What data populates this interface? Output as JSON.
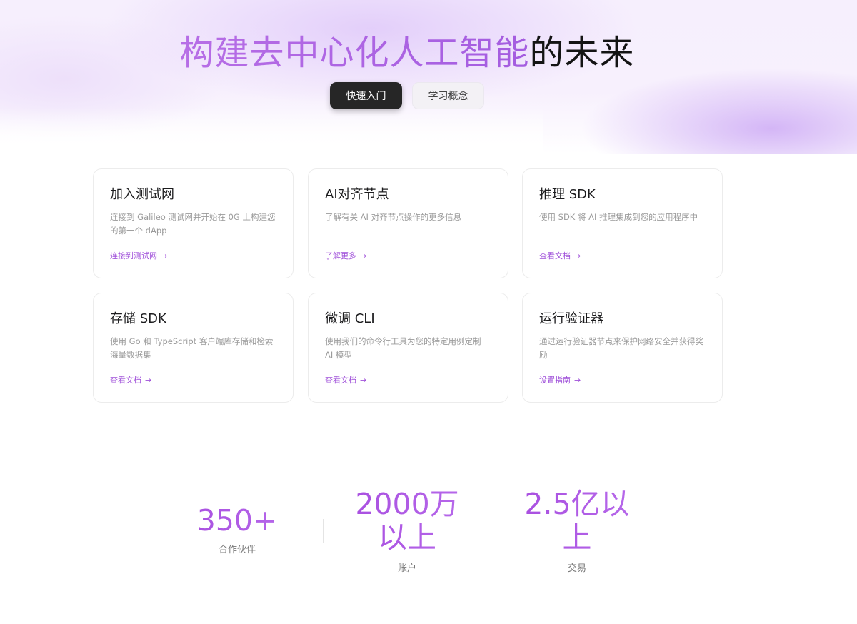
{
  "hero": {
    "title_gradient": "构建去中心化人工智能",
    "title_dark": "的未来",
    "primary_button": "快速入门",
    "secondary_button": "学习概念"
  },
  "cards": [
    {
      "title": "加入测试网",
      "desc_line1": "连接到 Galileo 测试网并开始在 0G 上构建您",
      "desc_line2": "的第一个 dApp",
      "link": "连接到测试网",
      "arrow": "→"
    },
    {
      "title": "AI对齐节点",
      "desc_line1": "了解有关 AI 对齐节点操作的更多信息",
      "desc_line2": "",
      "link": "了解更多",
      "arrow": "→"
    },
    {
      "title": "推理 SDK",
      "desc_line1": "使用 SDK 将 AI 推理集成到您的应用程序中",
      "desc_line2": "",
      "link": "查看文档",
      "arrow": "→"
    },
    {
      "title": "存储 SDK",
      "desc_line1": "使用 Go 和 TypeScript 客户端库存储和检索",
      "desc_line2": "海量数据集",
      "link": "查看文档",
      "arrow": "→"
    },
    {
      "title": "微调 CLI",
      "desc_line1": "使用我们的命令行工具为您的特定用例定制",
      "desc_line2": "AI 模型",
      "link": "查看文档",
      "arrow": "→"
    },
    {
      "title": "运行验证器",
      "desc_line1": "通过运行验证器节点来保护网络安全并获得奖",
      "desc_line2": "励",
      "link": "设置指南",
      "arrow": "→"
    }
  ],
  "stats": [
    {
      "value_line1": "350+",
      "value_line2": "",
      "label": "合作伙伴"
    },
    {
      "value_line1": "2000万",
      "value_line2": "以上",
      "label": "账户"
    },
    {
      "value_line1": "2.5亿以",
      "value_line2": "上",
      "label": "交易"
    }
  ],
  "colors": {
    "accent": "#9f4fd9",
    "primary_button_bg": "#262626",
    "secondary_button_bg": "#f3f1f5"
  }
}
